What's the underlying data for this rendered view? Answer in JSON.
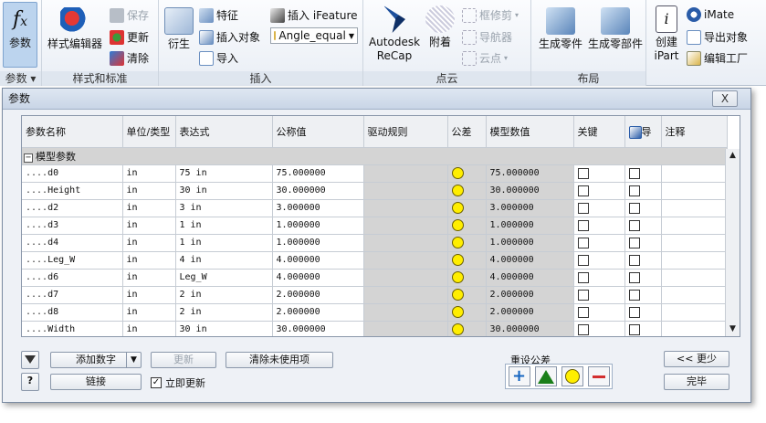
{
  "ribbon": {
    "params_group": {
      "fx_label": "参数",
      "label": "参数 ▾"
    },
    "styles_group": {
      "editor": "样式编辑器",
      "save": "保存",
      "update": "更新",
      "purge": "清除",
      "label": "样式和标准"
    },
    "insert_group": {
      "derive": "衍生",
      "feature": "特征",
      "insert_object": "插入对象",
      "import": "导入",
      "insert_ifeature": "插入 iFeature",
      "angle_combo": "Angle_equal",
      "label": "插入"
    },
    "pointcloud_group": {
      "recap_line1": "Autodesk",
      "recap_line2": "ReCap",
      "attach": "附着",
      "crop": "框修剪",
      "navigator": "导航器",
      "cloud": "云点",
      "label": "点云"
    },
    "layout_group": {
      "make_part": "生成零件",
      "make_components": "生成零部件",
      "label": "布局"
    },
    "ipart_group": {
      "create_line1": "创建",
      "create_line2": "iPart",
      "imate": "iMate",
      "export_object": "导出对象",
      "edit_factory": "编辑工厂"
    }
  },
  "dialog": {
    "title": "参数",
    "close": "X",
    "columns": [
      "参数名称",
      "单位/类型",
      "表达式",
      "公称值",
      "驱动规则",
      "公差",
      "模型数值",
      "关键",
      "导",
      "注释"
    ],
    "group_row": "模型参数",
    "rows": [
      {
        "name": "d0",
        "unit": "in",
        "expr": "75 in",
        "nominal": "75.000000",
        "model": "75.000000"
      },
      {
        "name": "Height",
        "unit": "in",
        "expr": "30 in",
        "nominal": "30.000000",
        "model": "30.000000"
      },
      {
        "name": "d2",
        "unit": "in",
        "expr": "3 in",
        "nominal": "3.000000",
        "model": "3.000000"
      },
      {
        "name": "d3",
        "unit": "in",
        "expr": "1 in",
        "nominal": "1.000000",
        "model": "1.000000"
      },
      {
        "name": "d4",
        "unit": "in",
        "expr": "1 in",
        "nominal": "1.000000",
        "model": "1.000000"
      },
      {
        "name": "Leg_W",
        "unit": "in",
        "expr": "4 in",
        "nominal": "4.000000",
        "model": "4.000000"
      },
      {
        "name": "d6",
        "unit": "in",
        "expr": "Leg_W",
        "nominal": "4.000000",
        "model": "4.000000"
      },
      {
        "name": "d7",
        "unit": "in",
        "expr": "2 in",
        "nominal": "2.000000",
        "model": "2.000000"
      },
      {
        "name": "d8",
        "unit": "in",
        "expr": "2 in",
        "nominal": "2.000000",
        "model": "2.000000"
      },
      {
        "name": "Width",
        "unit": "in",
        "expr": "30 in",
        "nominal": "30.000000",
        "model": "30.000000"
      }
    ],
    "footer": {
      "add_number": "添加数字",
      "update": "更新",
      "purge_unused": "清除未使用项",
      "link": "链接",
      "immediate_update": "立即更新",
      "reset_tolerance": "重设公差",
      "less": "<< 更少",
      "done": "完毕"
    }
  }
}
